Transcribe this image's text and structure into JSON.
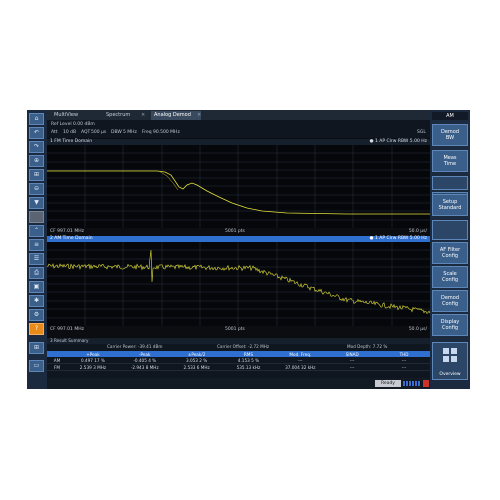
{
  "tabs": {
    "multiview": "MultiView",
    "spectrum": "Spectrum",
    "analog_demod": "Analog Demod",
    "close": "×"
  },
  "info": {
    "ref_level": "Ref Level 0.00 dBm",
    "att": "Att",
    "att_value": "10 dB",
    "aqt": "AQT",
    "aqt_value": "500 µs",
    "dbw": "DBW",
    "dbw_value": "5 MHz",
    "freq": "Freq",
    "freq_value": "90.500 MHz",
    "sgl": "SGL"
  },
  "window1": {
    "title": "1 FM Time Domain",
    "right": "● 1 AP Clrw  RBW 5.00 Hz",
    "footer_left": "CF 997.01 MHz",
    "footer_mid": "5001 pts",
    "footer_right": "50.0 µs/"
  },
  "window2": {
    "title": "2 AM Time Domain",
    "right": "● 1 AP Clrw  RBW 5.00 Hz",
    "footer_left": "CF 997.01 MHz",
    "footer_mid": "5001 pts",
    "footer_right": "50.0 µs/"
  },
  "result": {
    "title": "3 Result Summary",
    "carrier_power": "Carrier Power: -39.41 dBm",
    "carrier_offset": "Carrier Offset: -2.72 MHz",
    "mod_depth": "Mod Depth: 7.72 %",
    "headers": [
      "",
      "+Peak",
      "-Peak",
      "±Peak/2",
      "RMS",
      "Mod. Freq.",
      "SINAD",
      "THD"
    ],
    "rows": [
      [
        "AM",
        "0.497 17 %",
        "-0.405 4 %",
        "3.053 2 %",
        "4.153 5 %",
        "---",
        "---",
        "---"
      ],
      [
        "FM",
        "2.539 3 MHz",
        "-2.943 8 MHz",
        "2.533 6 MHz",
        "535.13 kHz",
        "37.004 32 kHz",
        "---",
        "---"
      ]
    ]
  },
  "softkeys": {
    "mode": "AM",
    "k1": "Demod\nBW",
    "k2": "Meas\nTime",
    "k3": "Setup\nStandard",
    "k4": "AF Filter\nConfig",
    "k5": "Scale\nConfig",
    "k6": "Demod\nConfig",
    "k7": "Display\nConfig",
    "overview": "Overview"
  },
  "status": {
    "ready": "Ready"
  },
  "colors": {
    "trace": "#e6e23a",
    "accent_blue": "#2f6fd0",
    "softkey": "#3a5f8a",
    "screen_bg": "#0b0d11"
  }
}
